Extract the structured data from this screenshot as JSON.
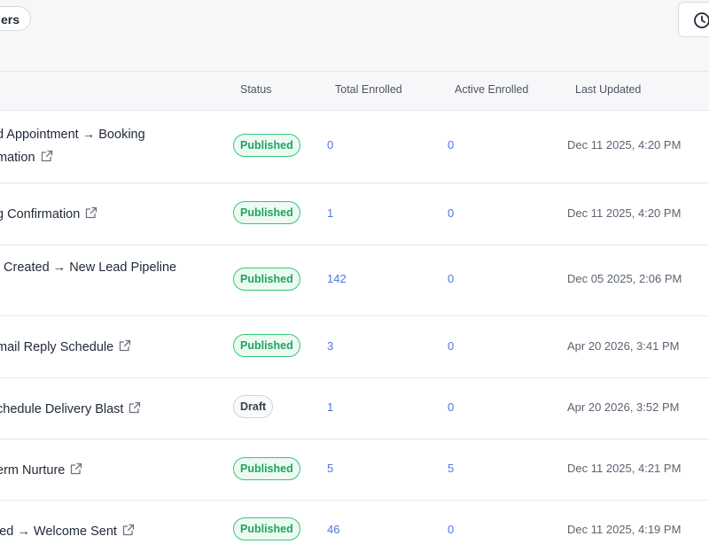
{
  "toolbar": {
    "filters_label": "ers"
  },
  "table": {
    "columns": {
      "status": "Status",
      "total_enrolled": "Total Enrolled",
      "active_enrolled": "Active Enrolled",
      "last_updated": "Last Updated"
    },
    "rows": [
      {
        "name_line1": "d Appointment → Booking",
        "name_line2": "mation",
        "status": "Published",
        "total": "0",
        "active": "0",
        "updated": "Dec 11 2025, 4:20 PM"
      },
      {
        "name_line1": "g Confirmation",
        "status": "Published",
        "total": "1",
        "active": "0",
        "updated": "Dec 11 2025, 4:20 PM"
      },
      {
        "name_line1": "t Created → New Lead Pipeline",
        "status": "Published",
        "total": "142",
        "active": "0",
        "updated": "Dec 05 2025, 2:06 PM"
      },
      {
        "name_line1": "mail Reply Schedule",
        "status": "Published",
        "total": "3",
        "active": "0",
        "updated": "Apr 20 2026, 3:41 PM"
      },
      {
        "name_line1": "chedule Delivery Blast",
        "status": "Draft",
        "total": "1",
        "active": "0",
        "updated": "Apr 20 2026, 3:52 PM"
      },
      {
        "name_line1": "erm Nurture",
        "status": "Published",
        "total": "5",
        "active": "5",
        "updated": "Dec 11 2025, 4:21 PM"
      },
      {
        "name_line1": "ied → Welcome Sent",
        "status": "Published",
        "total": "46",
        "active": "0",
        "updated": "Dec 11 2025, 4:19 PM"
      }
    ]
  },
  "colors": {
    "published": "#34c77b",
    "link_number": "#4f74e0"
  },
  "icons": {
    "history": "clock-icon",
    "external_link": "external-link-icon"
  }
}
